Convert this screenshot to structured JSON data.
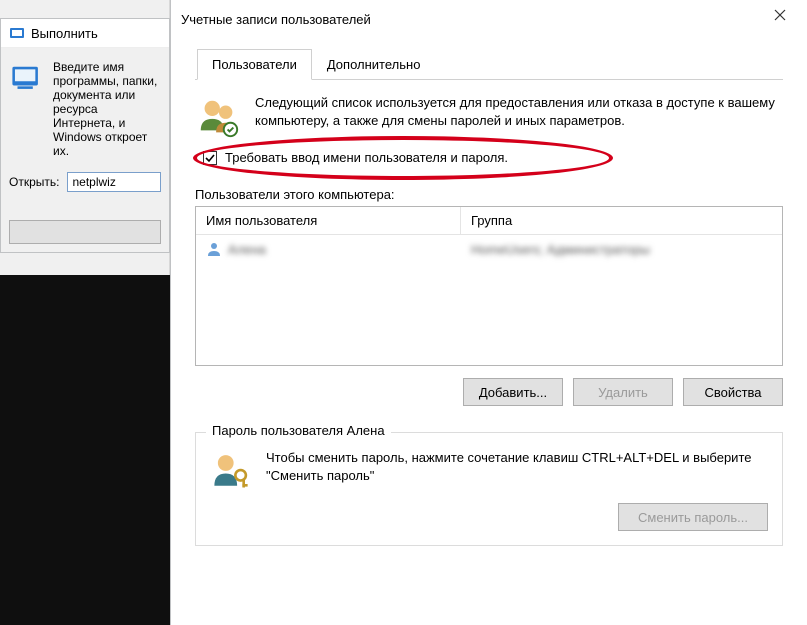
{
  "run_dialog": {
    "title": "Выполнить",
    "description": "Введите имя программы, папки, документа или ресурса Интернета, и Windows откроет их.",
    "open_label": "Открыть:",
    "input_value": "netplwiz"
  },
  "user_accounts": {
    "title": "Учетные записи пользователей",
    "tabs": {
      "users": "Пользователи",
      "advanced": "Дополнительно"
    },
    "info_text": "Следующий список используется для предоставления или отказа в доступе к вашему компьютеру, а также для смены паролей и иных параметров.",
    "require_login_checkbox": {
      "checked": true,
      "label": "Требовать ввод имени пользователя и пароля."
    },
    "list_label": "Пользователи этого компьютера:",
    "columns": {
      "username": "Имя пользователя",
      "group": "Группа"
    },
    "rows": [
      {
        "username": "Алена",
        "group": "HomeUsers; Администраторы"
      }
    ],
    "buttons": {
      "add": "Добавить...",
      "remove": "Удалить",
      "properties": "Свойства"
    },
    "password_box": {
      "title": "Пароль пользователя Алена",
      "text": "Чтобы сменить пароль, нажмите сочетание клавиш CTRL+ALT+DEL и выберите \"Сменить пароль\"",
      "button": "Сменить пароль..."
    }
  }
}
